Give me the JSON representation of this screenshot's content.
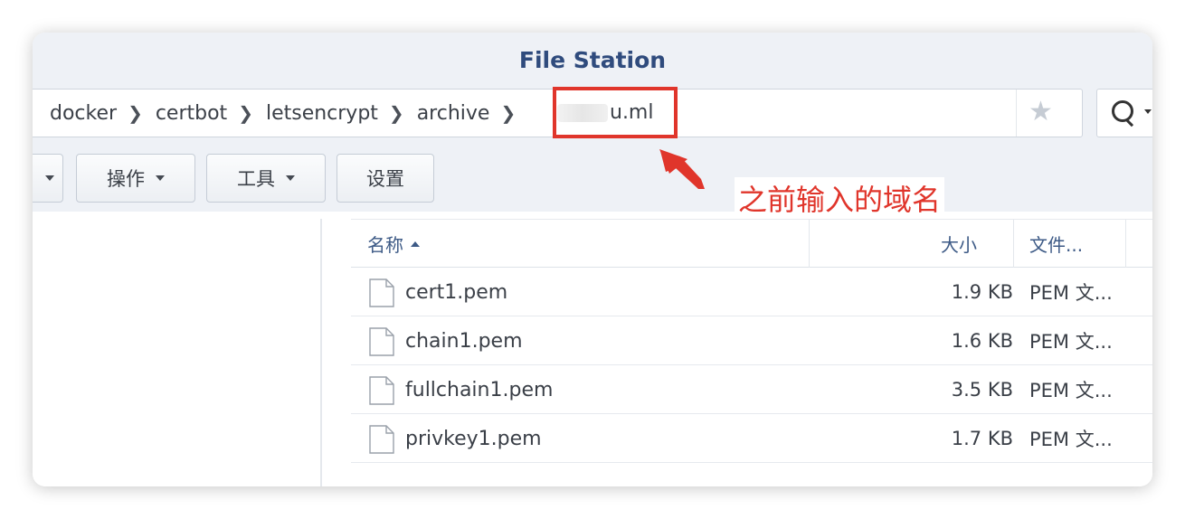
{
  "window": {
    "title": "File Station"
  },
  "path": {
    "crumbs": [
      "docker",
      "certbot",
      "letsencrypt",
      "archive"
    ],
    "current_suffix": "u.ml"
  },
  "toolbar": {
    "buttons": [
      {
        "label": "操作"
      },
      {
        "label": "工具"
      },
      {
        "label": "设置"
      }
    ]
  },
  "table": {
    "columns": {
      "name": "名称",
      "size": "大小",
      "type": "文件..."
    },
    "rows": [
      {
        "name": "cert1.pem",
        "size": "1.9 KB",
        "type": "PEM 文..."
      },
      {
        "name": "chain1.pem",
        "size": "1.6 KB",
        "type": "PEM 文..."
      },
      {
        "name": "fullchain1.pem",
        "size": "3.5 KB",
        "type": "PEM 文..."
      },
      {
        "name": "privkey1.pem",
        "size": "1.7 KB",
        "type": "PEM 文..."
      }
    ]
  },
  "annotation": {
    "text": "之前输入的域名",
    "color": "#e0352b"
  },
  "icons": [
    "chevron-right-icon",
    "star-icon",
    "search-icon",
    "chevron-down-icon",
    "file-icon",
    "sort-ascending-icon"
  ]
}
